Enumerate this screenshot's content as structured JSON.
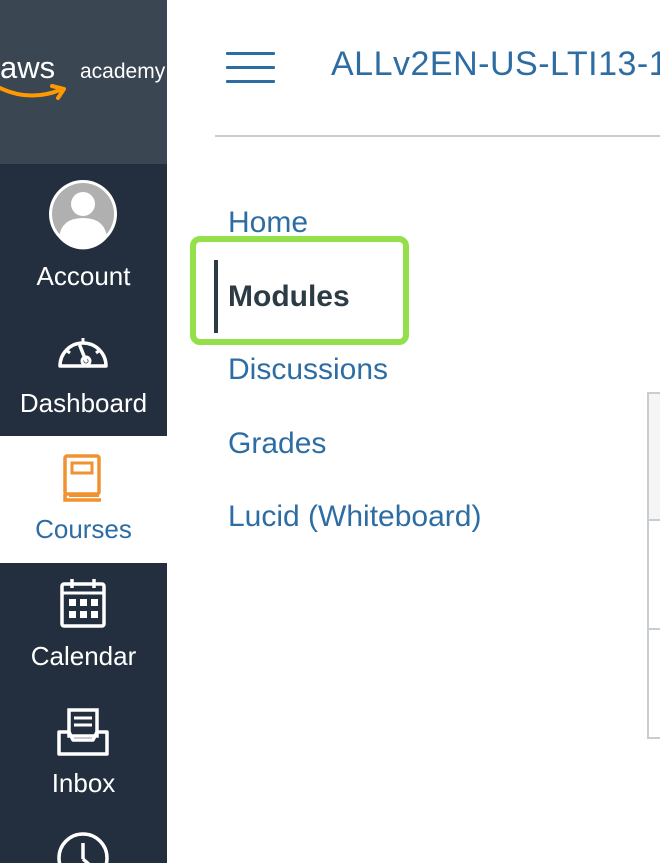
{
  "brand": {
    "logo_word": "aws",
    "logo_sub": "academy"
  },
  "global_nav": {
    "items": [
      {
        "label": "Account",
        "icon": "account-avatar-icon"
      },
      {
        "label": "Dashboard",
        "icon": "dashboard-gauge-icon"
      },
      {
        "label": "Courses",
        "icon": "courses-book-icon",
        "active": true
      },
      {
        "label": "Calendar",
        "icon": "calendar-icon"
      },
      {
        "label": "Inbox",
        "icon": "inbox-icon"
      },
      {
        "label": "",
        "icon": "history-clock-icon"
      }
    ]
  },
  "header": {
    "course_title": "ALLv2EN-US-LTI13-1"
  },
  "course_nav": {
    "items": [
      {
        "label": "Home"
      },
      {
        "label": "Modules",
        "active": true
      },
      {
        "label": "Discussions"
      },
      {
        "label": "Grades"
      },
      {
        "label": "Lucid (Whiteboard)"
      }
    ]
  },
  "colors": {
    "nav_bg": "#232f3e",
    "logo_bg": "#3a4651",
    "link": "#2d6da3",
    "active_text": "#2d3b45",
    "highlight": "#93e04a",
    "courses_icon": "#f0922f"
  }
}
